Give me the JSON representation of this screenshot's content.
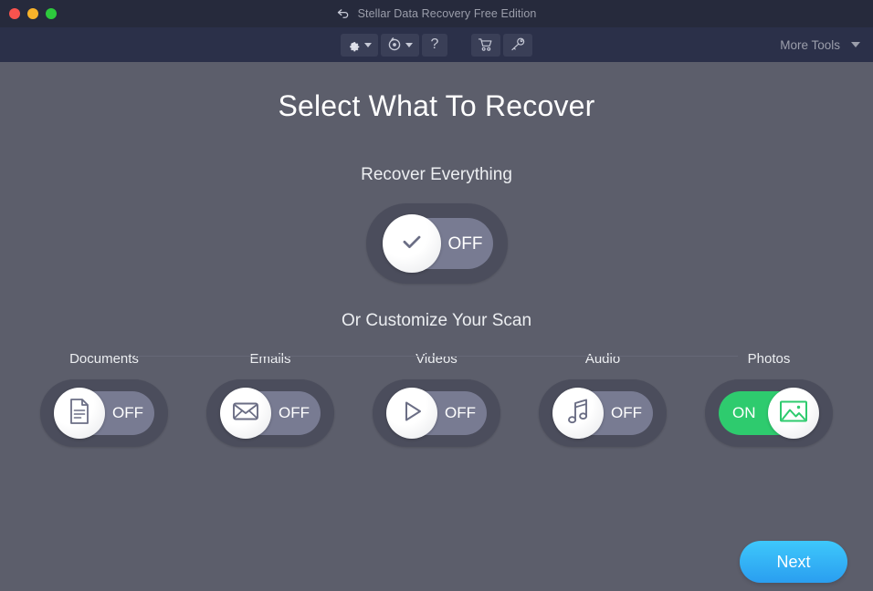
{
  "window": {
    "title": "Stellar Data Recovery Free Edition",
    "title_icon": "back-arrow-icon",
    "controls": [
      {
        "name": "close",
        "color": "#f9534e"
      },
      {
        "name": "minimize",
        "color": "#f8b32a"
      },
      {
        "name": "maximize",
        "color": "#2dc93d"
      }
    ]
  },
  "toolbar": {
    "buttons": [
      {
        "name": "settings",
        "icon": "gear-icon",
        "has_caret": true
      },
      {
        "name": "recovery-history",
        "icon": "restore-clock-icon",
        "has_caret": true
      },
      {
        "name": "help",
        "icon": "question-mark-icon",
        "label": "?",
        "has_caret": false
      },
      {
        "name": "buy",
        "icon": "shopping-cart-icon",
        "has_caret": false
      },
      {
        "name": "activate",
        "icon": "key-icon",
        "has_caret": false
      }
    ],
    "more_tools_label": "More Tools"
  },
  "main": {
    "page_title": "Select What To Recover",
    "recover_everything_label": "Recover Everything",
    "recover_everything_state": "OFF",
    "recover_everything_icon": "check-icon",
    "customize_label": "Or Customize Your Scan",
    "categories": [
      {
        "label": "Documents",
        "state": "OFF",
        "icon": "document-icon",
        "on": false
      },
      {
        "label": "Emails",
        "state": "OFF",
        "icon": "envelope-icon",
        "on": false
      },
      {
        "label": "Videos",
        "state": "OFF",
        "icon": "play-icon",
        "on": false
      },
      {
        "label": "Audio",
        "state": "OFF",
        "icon": "music-note-icon",
        "on": false
      },
      {
        "label": "Photos",
        "state": "ON",
        "icon": "image-icon",
        "on": true
      }
    ],
    "next_label": "Next"
  },
  "colors": {
    "header": "#262a3c",
    "toolbar": "#2b3049",
    "body": "#5c5e6b",
    "toggle_off_track": "#787b92",
    "toggle_on_track": "#2ecb6e",
    "accent_blue": "#2a9ef0"
  }
}
